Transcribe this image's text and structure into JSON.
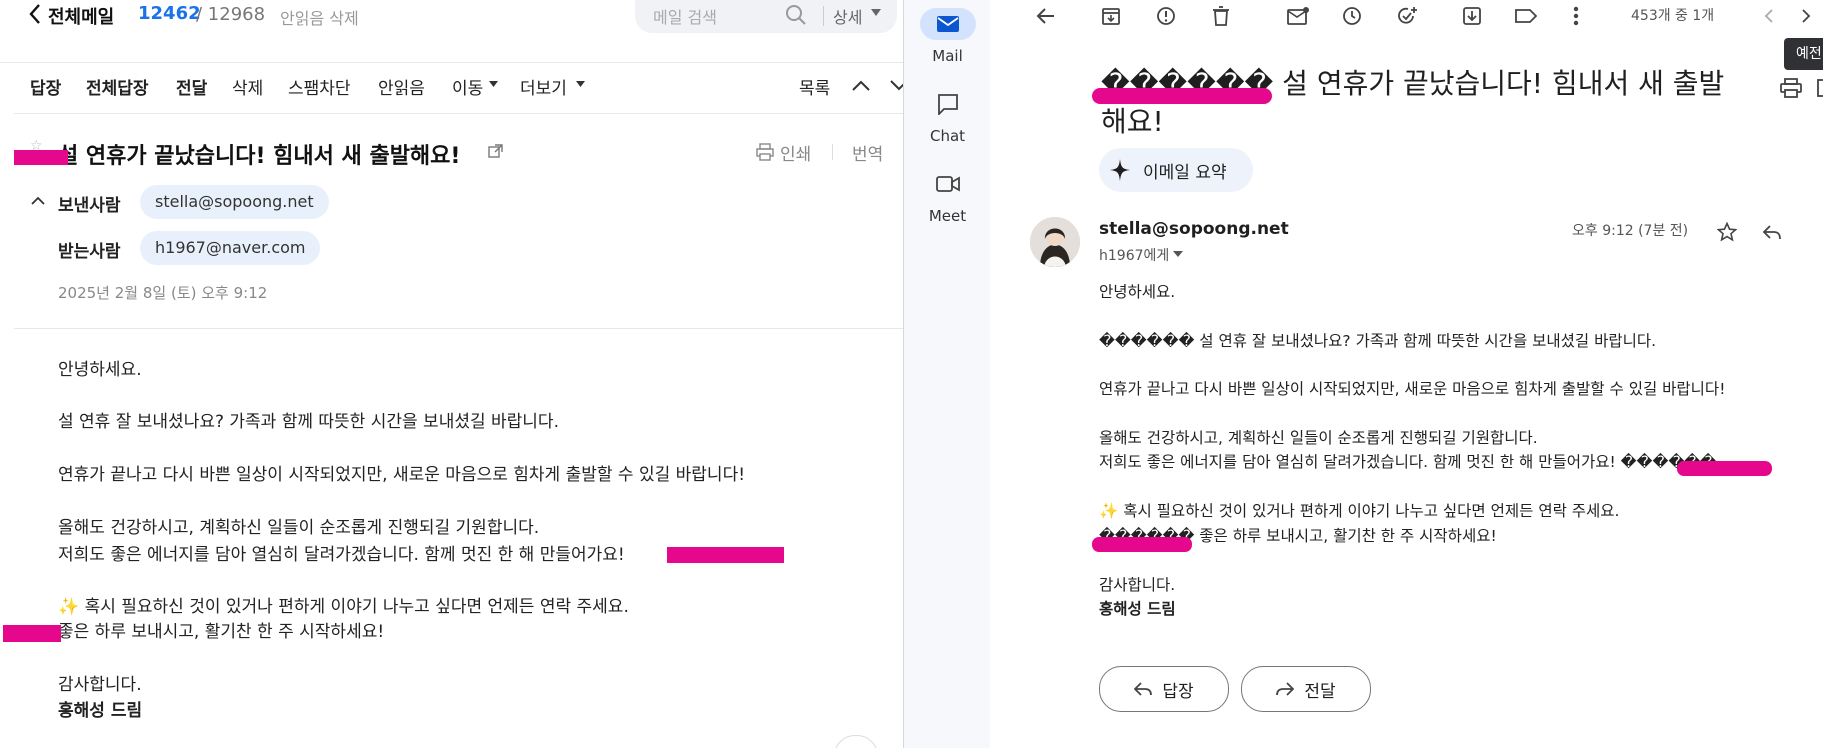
{
  "naver": {
    "back_title": "전체메일",
    "unread_count": "12462",
    "total_count": "/ 12968",
    "unread_delete": "안읽음 삭제",
    "search_placeholder": "메일 검색",
    "detail": "상세",
    "toolbar": [
      "답장",
      "전체답장",
      "전달",
      "삭제",
      "스팸차단",
      "안읽음",
      "이동",
      "더보기"
    ],
    "list_label": "목록",
    "subject": "설 연휴가 끝났습니다! 힘내서 새 출발해요!",
    "print": "인쇄",
    "translate": "번역",
    "sender_label": "보낸사람",
    "sender": "stella@sopoong.net",
    "recipient_label": "받는사람",
    "recipient": "h1967@naver.com",
    "date": "2025년 2월 8일 (토) 오후 9:12",
    "body": [
      "안녕하세요.",
      "설 연휴 잘 보내셨나요? 가족과 함께 따뜻한 시간을 보내셨길 바랍니다.",
      "연휴가 끝나고 다시 바쁜 일상이 시작되었지만, 새로운 마음으로 힘차게 출발할 수 있길 바랍니다!",
      "올해도 건강하시고, 계획하신 일들이 순조롭게 진행되길 기원합니다.",
      "저희도 좋은 에너지를 담아 열심히 달려가겠습니다. 함께 멋진 한 해 만들어가요!",
      "✨ 혹시 필요하신 것이 있거나 편하게 이야기 나누고 싶다면 언제든 연락 주세요.",
      "좋은 하루 보내시고, 활기찬 한 주 시작하세요!",
      "감사합니다."
    ],
    "signature": "홍해성 드림"
  },
  "rail": {
    "items": [
      {
        "label": "Mail",
        "icon": "mail-icon"
      },
      {
        "label": "Chat",
        "icon": "chat-icon"
      },
      {
        "label": "Meet",
        "icon": "meet-icon"
      }
    ]
  },
  "gmail": {
    "page_count": "453개 중 1개",
    "tooltip": "예전",
    "subject_garbled": "������",
    "subject": " 설 연휴가 끝났습니다! 힘내서 새 출발",
    "subject_line2": "해요!",
    "summary_button": "이메일 요약",
    "sender": "stella@sopoong.net",
    "to": "h1967에게",
    "time": "오후 9:12 (7분 전)",
    "body": {
      "greeting": "안녕하세요.",
      "p1": "������ 설 연휴 잘 보내셨나요? 가족과 함께 따뜻한 시간을 보내셨길 바랍니다.",
      "p2": "연휴가 끝나고 다시 바쁜 일상이 시작되었지만, 새로운 마음으로 힘차게 출발할 수 있길 바랍니다!",
      "p3a": "올해도 건강하시고, 계획하신 일들이 순조롭게 진행되길 기원합니다.",
      "p3b": "저희도 좋은 에너지를 담아 열심히 달려가겠습니다. 함께 멋진 한 해 만들어가요! ������",
      "p4a": "✨ 혹시 필요하신 것이 있거나 편하게 이야기 나누고 싶다면 언제든 연락 주세요.",
      "p4b": "������ 좋은 하루 보내시고, 활기찬 한 주 시작하세요!",
      "thanks": "감사합니다.",
      "signature": "홍해성 드림"
    },
    "reply": "답장",
    "forward": "전달"
  },
  "colors": {
    "redaction": "#e5088c",
    "naver_blue": "#1a73e8",
    "chip_bg": "#e8f1fb",
    "rail_bg": "#f6f8fc",
    "rail_active": "#d3e3fd"
  }
}
